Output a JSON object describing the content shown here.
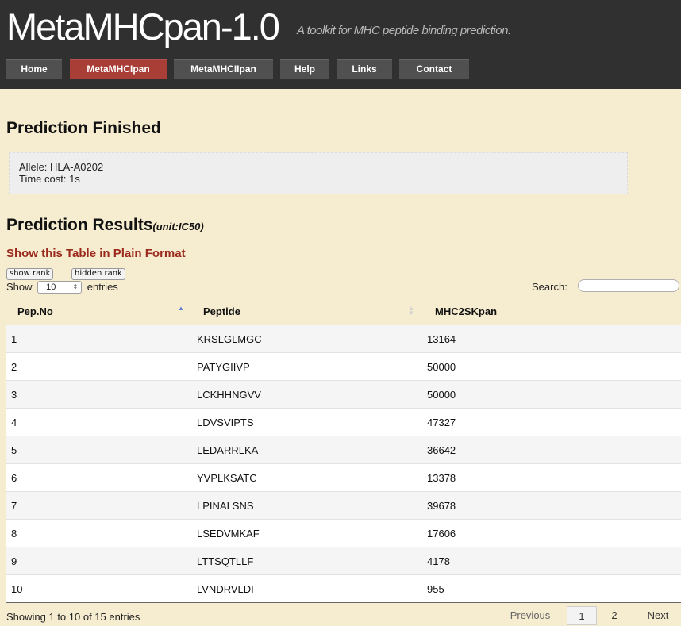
{
  "header": {
    "title": "MetaMHCpan-1.0",
    "tagline": "A toolkit for MHC peptide binding prediction.",
    "nav": [
      {
        "label": "Home",
        "active": false
      },
      {
        "label": "MetaMHCIpan",
        "active": true
      },
      {
        "label": "MetaMHCIIpan",
        "active": false
      },
      {
        "label": "Help",
        "active": false
      },
      {
        "label": "Links",
        "active": false
      },
      {
        "label": "Contact",
        "active": false
      }
    ]
  },
  "status": {
    "title": "Prediction Finished",
    "allele": "Allele: HLA-A0202",
    "time_cost": "Time cost: 1s"
  },
  "results": {
    "title": "Prediction Results",
    "unit": "(unit:IC50)",
    "plain_format_link": "Show this Table in Plain Format",
    "show_rank_button": "show rank",
    "hidden_rank_button": "hidden rank",
    "length_prefix": "Show",
    "length_value": "10",
    "length_suffix": "entries",
    "search_label": "Search:",
    "search_value": "",
    "columns": [
      "Pep.No",
      "Peptide",
      "MHC2SKpan"
    ],
    "rows": [
      [
        "1",
        "KRSLGLMGC",
        "13164"
      ],
      [
        "2",
        "PATYGIIVP",
        "50000"
      ],
      [
        "3",
        "LCKHHNGVV",
        "50000"
      ],
      [
        "4",
        "LDVSVIPTS",
        "47327"
      ],
      [
        "5",
        "LEDARRLKA",
        "36642"
      ],
      [
        "6",
        "YVPLKSATC",
        "13378"
      ],
      [
        "7",
        "LPINALSNS",
        "39678"
      ],
      [
        "8",
        "LSEDVMKAF",
        "17606"
      ],
      [
        "9",
        "LTTSQTLLF",
        "4178"
      ],
      [
        "10",
        "LVNDRVLDI",
        "955"
      ]
    ],
    "info": "Showing 1 to 10 of 15 entries",
    "pagination": {
      "previous": "Previous",
      "pages": [
        "1",
        "2"
      ],
      "current_page": "1",
      "next": "Next"
    }
  },
  "colors": {
    "header_bg": "#303030",
    "nav_bg": "#505050",
    "nav_active_bg": "#a93e36",
    "page_bg": "#f6ecd0",
    "link_red": "#9b2a1c",
    "sort_active": "#5e7fd4"
  }
}
